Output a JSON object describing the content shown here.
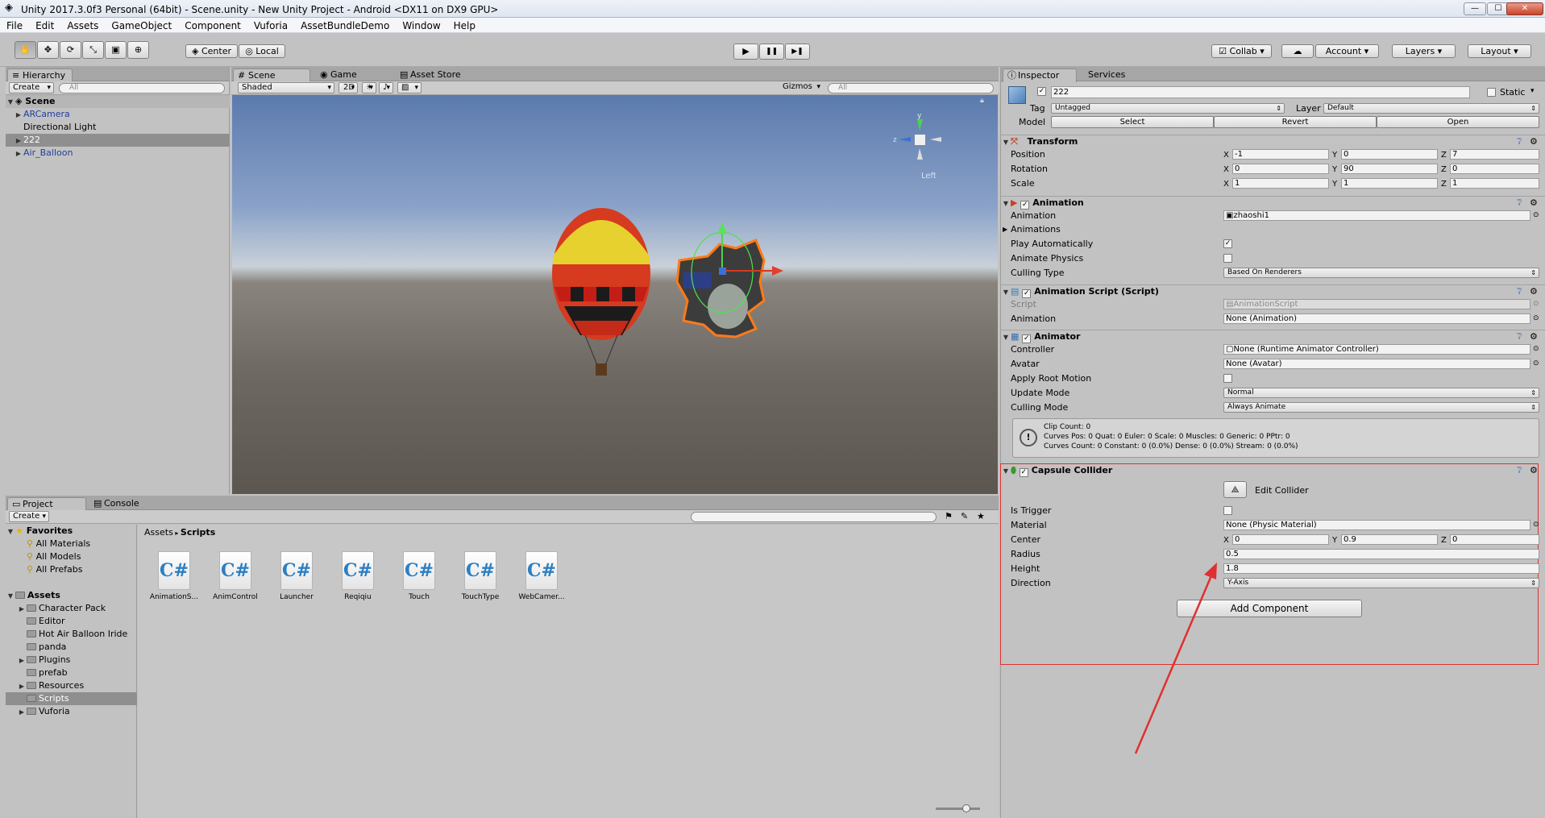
{
  "window": {
    "title": "Unity 2017.3.0f3 Personal (64bit) - Scene.unity - New Unity Project - Android <DX11 on DX9 GPU>",
    "min": "—",
    "max": "☐",
    "close": "✕"
  },
  "menu": [
    "File",
    "Edit",
    "Assets",
    "GameObject",
    "Component",
    "Vuforia",
    "AssetBundleDemo",
    "Window",
    "Help"
  ],
  "toolbar": {
    "pivot": "Center",
    "space": "Local",
    "play": "▶",
    "pause": "❚❚",
    "step": "▶❚",
    "collab": "Collab",
    "account": "Account",
    "layers": "Layers",
    "layout": "Layout"
  },
  "hierarchy": {
    "tab": "Hierarchy",
    "create": "Create",
    "search": "All",
    "scene": "Scene",
    "items": [
      {
        "name": "ARCamera",
        "expandable": true,
        "color": "#1f3f9f"
      },
      {
        "name": "Directional Light",
        "expandable": false,
        "color": "#000000"
      },
      {
        "name": "222",
        "expandable": true,
        "color": "#1f3f9f",
        "selected": true
      },
      {
        "name": "Air_Balloon",
        "expandable": true,
        "color": "#1f3f9f"
      }
    ]
  },
  "scene_tabs": {
    "scene": "Scene",
    "game": "Game",
    "store": "Asset Store"
  },
  "scene_bar": {
    "shading": "Shaded",
    "mode2d": "2D",
    "gizmos": "Gizmos",
    "search": "All",
    "orient": "Left"
  },
  "project": {
    "tab": "Project",
    "console": "Console",
    "create": "Create",
    "favorites": "Favorites",
    "fav_items": [
      "All Materials",
      "All Models",
      "All Prefabs"
    ],
    "assets": "Assets",
    "folders": [
      {
        "name": "Character Pack",
        "expandable": true
      },
      {
        "name": "Editor",
        "expandable": false
      },
      {
        "name": "Hot Air Balloon Iride",
        "expandable": false
      },
      {
        "name": "panda",
        "expandable": false
      },
      {
        "name": "Plugins",
        "expandable": true
      },
      {
        "name": "prefab",
        "expandable": false
      },
      {
        "name": "Resources",
        "expandable": true
      },
      {
        "name": "Scripts",
        "expandable": false,
        "selected": true
      },
      {
        "name": "Vuforia",
        "expandable": true
      }
    ],
    "breadcrumb_root": "Assets",
    "breadcrumb_leaf": "Scripts",
    "files": [
      "AnimationS...",
      "AnimControl",
      "Launcher",
      "Reqiqiu",
      "Touch",
      "TouchType",
      "WebCamer..."
    ],
    "file_glyph": "C#"
  },
  "inspector": {
    "tab": "Inspector",
    "services": "Services",
    "object_name": "222",
    "static_label": "Static",
    "tag_label": "Tag",
    "tag": "Untagged",
    "layer_label": "Layer",
    "layer": "Default",
    "model_label": "Model",
    "select": "Select",
    "revert": "Revert",
    "open": "Open",
    "transform": {
      "title": "Transform",
      "rows": [
        {
          "label": "Position",
          "x": "-1",
          "y": "0",
          "z": "7"
        },
        {
          "label": "Rotation",
          "x": "0",
          "y": "90",
          "z": "0"
        },
        {
          "label": "Scale",
          "x": "1",
          "y": "1",
          "z": "1"
        }
      ]
    },
    "animation": {
      "title": "Animation",
      "animation_label": "Animation",
      "animation_value": "zhaoshi1",
      "animations_label": "Animations",
      "play_auto_label": "Play Automatically",
      "animate_physics_label": "Animate Physics",
      "culling_label": "Culling Type",
      "culling_value": "Based On Renderers"
    },
    "animation_script": {
      "title": "Animation Script (Script)",
      "script_label": "Script",
      "script_value": "AnimationScript",
      "anim_label": "Animation",
      "anim_value": "None (Animation)"
    },
    "animator": {
      "title": "Animator",
      "controller_label": "Controller",
      "controller_value": "None (Runtime Animator Controller)",
      "avatar_label": "Avatar",
      "avatar_value": "None (Avatar)",
      "root_motion_label": "Apply Root Motion",
      "update_label": "Update Mode",
      "update_value": "Normal",
      "culling_label": "Culling Mode",
      "culling_value": "Always Animate",
      "info_1": "Clip Count: 0",
      "info_2": "Curves Pos: 0 Quat: 0 Euler: 0 Scale: 0 Muscles: 0 Generic: 0 PPtr: 0",
      "info_3": "Curves Count: 0 Constant: 0 (0.0%) Dense: 0 (0.0%) Stream: 0 (0.0%)"
    },
    "capsule": {
      "title": "Capsule Collider",
      "edit_collider": "Edit Collider",
      "trigger_label": "Is Trigger",
      "material_label": "Material",
      "material_value": "None (Physic Material)",
      "center_label": "Center",
      "cx": "0",
      "cy": "0.9",
      "cz": "0",
      "radius_label": "Radius",
      "radius_value": "0.5",
      "height_label": "Height",
      "height_value": "1.8",
      "direction_label": "Direction",
      "direction_value": "Y-Axis"
    },
    "add_component": "Add Component"
  },
  "colors": {
    "accent_red": "#e03030",
    "selection": "#8f8f8f",
    "sky_top": "#5b7aad",
    "ground": "#6e6862"
  }
}
